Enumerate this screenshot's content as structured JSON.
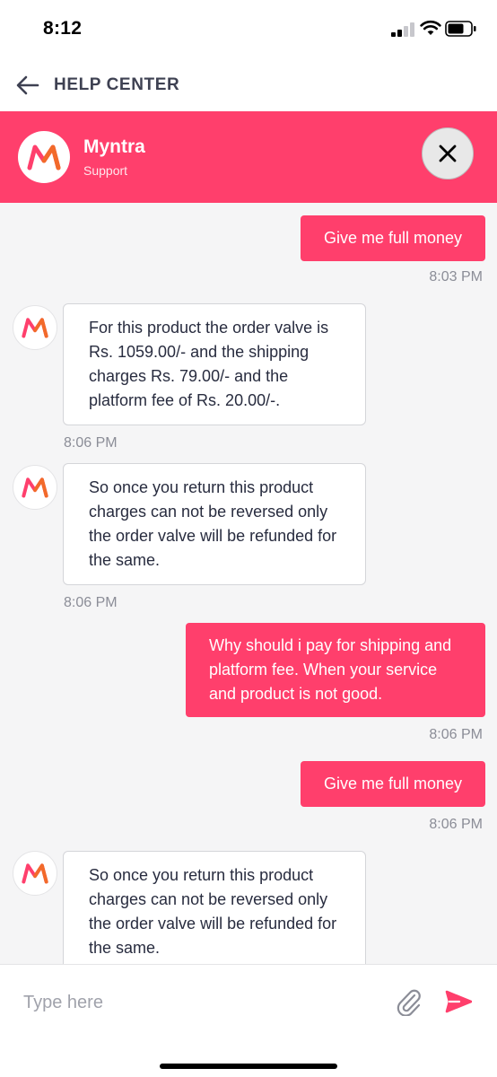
{
  "status_bar": {
    "time": "8:12"
  },
  "nav": {
    "title": "HELP CENTER"
  },
  "header": {
    "name": "Myntra",
    "subtitle": "Support"
  },
  "messages": [
    {
      "from": "user",
      "text": "Give me full money",
      "time": "8:03 PM"
    },
    {
      "from": "support",
      "text": "For this product the order valve is Rs. 1059.00/- and the shipping charges Rs. 79.00/- and the platform fee of Rs. 20.00/-.",
      "time": "8:06 PM"
    },
    {
      "from": "support",
      "text": "So once you return this product charges can not be reversed only the order valve will be refunded for the same.",
      "time": "8:06 PM"
    },
    {
      "from": "user",
      "text": "Why should i pay for shipping and platform fee. When your service and product is not good.",
      "time": "8:06 PM"
    },
    {
      "from": "user",
      "text": "Give me full money",
      "time": "8:06 PM"
    },
    {
      "from": "support",
      "text": "So once you return this product charges can not be reversed only the order valve will be refunded for the same.",
      "time": ""
    }
  ],
  "composer": {
    "placeholder": "Type here",
    "value": ""
  },
  "colors": {
    "brand": "#ff3f6c",
    "chat_background": "#f5f5f6"
  },
  "icons": {
    "back": "arrow-left-icon",
    "close": "close-icon",
    "attach": "paperclip-icon",
    "send": "send-icon",
    "logo": "myntra-logo"
  }
}
